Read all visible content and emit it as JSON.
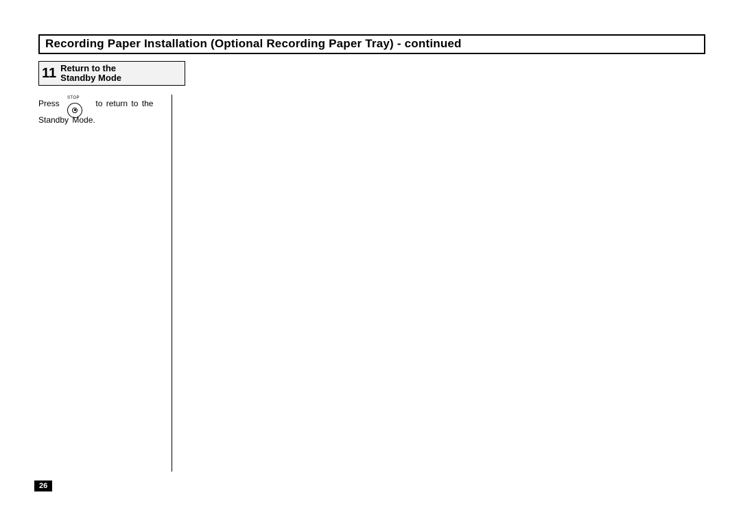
{
  "section": {
    "title": "Recording Paper Installation (Optional Recording Paper Tray) - continued"
  },
  "step": {
    "number": "11",
    "title_line1": "Return to the",
    "title_line2": "Standby Mode"
  },
  "instruction": {
    "press": "Press",
    "return_text": "to  return  to  the",
    "line2": "Standby Mode."
  },
  "button": {
    "stop_label": "STOP"
  },
  "page_number": "26"
}
